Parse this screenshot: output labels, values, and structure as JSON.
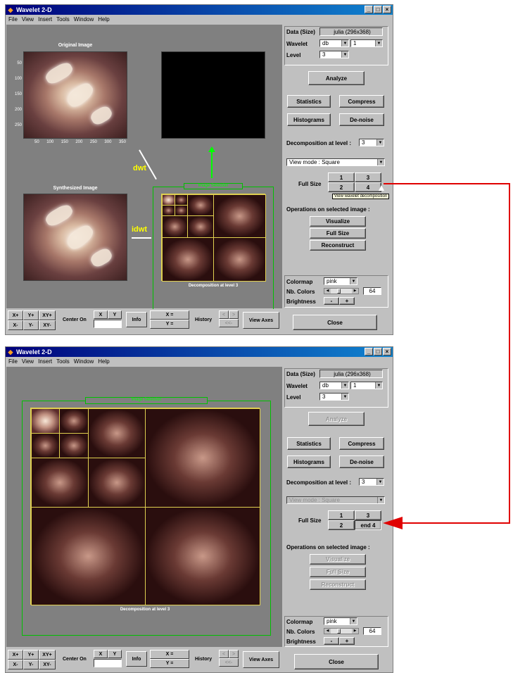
{
  "app_title": "Wavelet 2-D",
  "menu": [
    "File",
    "View",
    "Insert",
    "Tools",
    "Window",
    "Help"
  ],
  "window_controls": [
    "_",
    "□",
    "×"
  ],
  "top": {
    "original_title": "Original Image",
    "synth_title": "Synthesized Image",
    "y_ticks": [
      "50",
      "100",
      "150",
      "200",
      "250"
    ],
    "x_ticks": [
      "50",
      "100",
      "150",
      "200",
      "250",
      "300",
      "350"
    ],
    "dwt": "dwt",
    "idwt": "idwt",
    "image_selection": "Image Selection",
    "decomp_label": "Decomposition at level 3",
    "tooltip": "View wavelet decomposition"
  },
  "bottom": {
    "image_selection": "Image Selection",
    "decomp_label": "Decomposition at level 3"
  },
  "panel": {
    "data_label": "Data (Size)",
    "data_value": "julia (296x368)",
    "wavelet_label": "Wavelet",
    "wavelet_family": "db",
    "wavelet_order": "1",
    "level_label": "Level",
    "level_value": "3",
    "analyze": "Analyze",
    "statistics": "Statistics",
    "compress": "Compress",
    "histograms": "Histograms",
    "denoise": "De-noise",
    "decomp_at_level": "Decomposition at level :",
    "decomp_level_value": "3",
    "view_mode": "View mode : Square",
    "full_size": "Full Size",
    "fs_1": "1",
    "fs_2": "2",
    "fs_3": "3",
    "fs_4": "4",
    "fs_end4": "end 4",
    "ops_label": "Operations on selected image :",
    "visualize": "Visualize",
    "fullsize_btn": "Full Size",
    "reconstruct": "Reconstruct",
    "colormap_label": "Colormap",
    "colormap_value": "pink",
    "nbcolors_label": "Nb. Colors",
    "nbcolors_value": "64",
    "brightness_label": "Brightness",
    "minus": "-",
    "plus": "+",
    "close": "Close"
  },
  "bottombar": {
    "xplus": "X+",
    "yplus": "Y+",
    "xyplus": "XY+",
    "xminus": "X-",
    "yminus": "Y-",
    "xyminus": "XY-",
    "center_on": "Center On",
    "x": "X",
    "y": "Y",
    "info": "Info",
    "xeq": "X =",
    "yeq": "Y =",
    "history": "History",
    "hist_left": "<",
    "hist_right": ">",
    "hist_back": "<<-",
    "view_axes": "View Axes"
  },
  "colors": {
    "red_arrow": "#e00000",
    "green": "#00ff00",
    "title_bar": "#00007b"
  }
}
